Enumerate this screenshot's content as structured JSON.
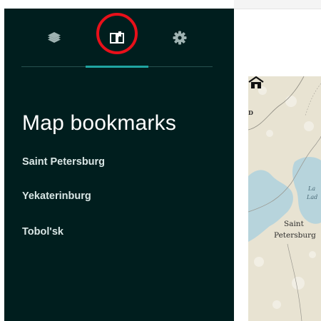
{
  "sidebar": {
    "tabs": [
      {
        "id": "layers",
        "icon": "layers-icon"
      },
      {
        "id": "bookmarks",
        "icon": "bookmark-book-icon",
        "active": true
      },
      {
        "id": "settings",
        "icon": "gear-icon"
      }
    ],
    "title": "Map bookmarks",
    "bookmarks": [
      "Saint Petersburg",
      "Yekaterinburg",
      "Tobol'sk"
    ]
  },
  "map": {
    "labels": {
      "saint": "Saint",
      "petersburg": "Petersburg",
      "edge_letter": "D",
      "lake_line1": "La",
      "lake_line2": "Lad"
    },
    "marker_icon": "home-icon"
  },
  "colors": {
    "sidebar_bg": "#001e1e",
    "accent": "#1fa4a1",
    "highlight": "#e8101a",
    "water": "#b7d4dc",
    "land": "#e8e3d2"
  }
}
